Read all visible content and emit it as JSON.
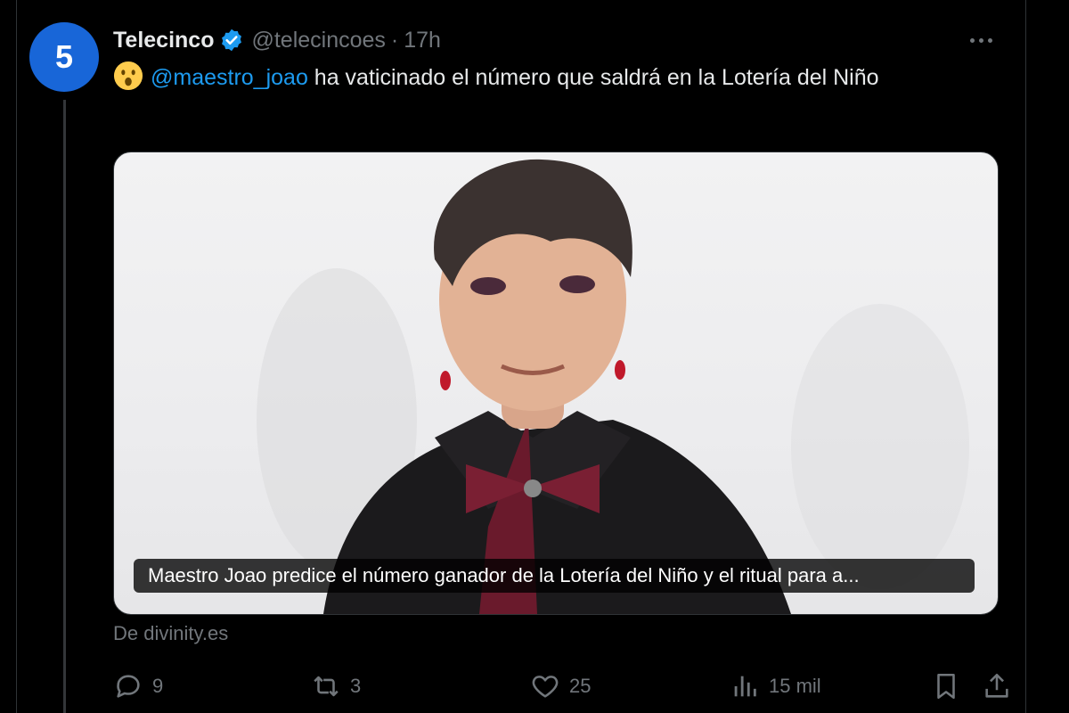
{
  "tweet": {
    "author": {
      "display_name": "Telecinco",
      "handle": "@telecincoes",
      "separator": "·",
      "time": "17h",
      "avatar_glyph": "5",
      "avatar_color": "#1866d8",
      "verified": true
    },
    "text": {
      "emoji": "hushed-face",
      "mention": "@maestro_joao",
      "body": " ha vaticinado el número que saldrá en la Lotería del Niño"
    },
    "card": {
      "title": "Maestro Joao predice el número ganador de la Lotería del Niño y el ritual para a...",
      "source": "De divinity.es"
    },
    "actions": {
      "replies": "9",
      "reposts": "3",
      "likes": "25",
      "views": "15 mil"
    }
  },
  "colors": {
    "background": "#000000",
    "text": "#e7e9ea",
    "muted": "#71767b",
    "accent": "#1d9bf0"
  }
}
